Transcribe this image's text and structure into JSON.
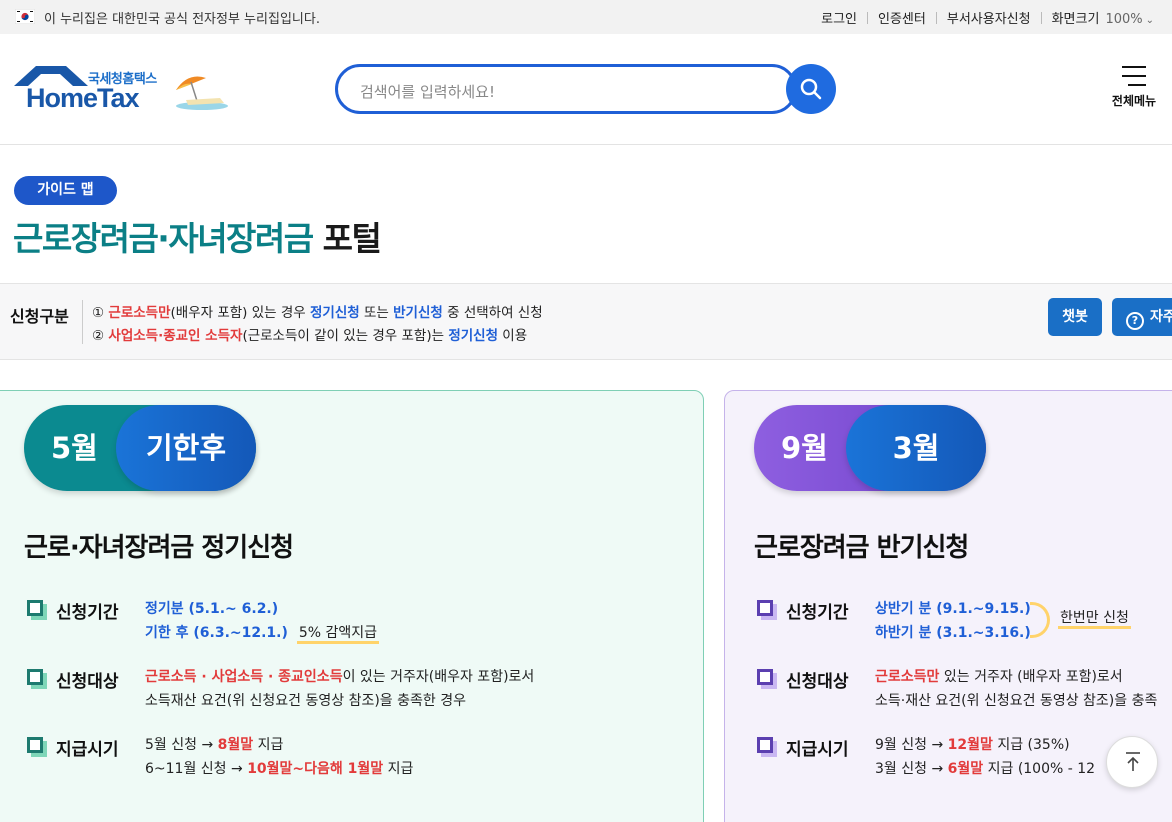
{
  "govbar": {
    "text": "이 누리집은 대한민국 공식 전자정부 누리집입니다.",
    "links": [
      "로그인",
      "인증센터",
      "부서사용자신청"
    ],
    "zoom_label": "화면크기",
    "zoom_value": "100%"
  },
  "header": {
    "logo_kr": "국세청홈택스",
    "logo_en": "HomeTax",
    "search_placeholder": "검색어를 입력하세요!",
    "allmenu_label": "전체메뉴"
  },
  "page": {
    "badge": "가이드 맵",
    "title_teal": "근로장려금·자녀장려금",
    "title_dark": " 포털"
  },
  "band": {
    "label": "신청구분",
    "line1": [
      "① ",
      "근로소득만",
      "(배우자 포함) 있는 경우 ",
      "정기신청",
      " 또는 ",
      "반기신청",
      " 중 선택하여 신청"
    ],
    "line2": [
      "② ",
      "사업소득·종교인 소득자",
      "(근로소득이 같이 있는 경우 포함)는 ",
      "정기신청",
      " 이용"
    ],
    "chat_button": "챗봇",
    "faq_button": "자주"
  },
  "left_card": {
    "pill_a": "5월",
    "pill_b": "기한후",
    "title": "근로·자녀장려금 정기신청",
    "period_label": "신청기간",
    "period_line1": "정기분 (5.1.~ 6.2.)",
    "period_line2": "기한 후 (6.3.~12.1.)",
    "period_note": "5% 감액지급",
    "target_label": "신청대상",
    "target_red": "근로소득 · 사업소득 · 종교인소득",
    "target_rest": "이 있는 거주자(배우자 포함)로서",
    "target_line2": "소득재산 요건(위 신청요건 동영상 참조)을 충족한 경우",
    "pay_label": "지급시기",
    "pay1_pre": "5월 신청 → ",
    "pay1_red": "8월말",
    "pay1_post": " 지급",
    "pay2_pre": "6~11월 신청 → ",
    "pay2_red": "10월말~다음해 1월말",
    "pay2_post": " 지급"
  },
  "right_card": {
    "pill_a": "9월",
    "pill_b": "3월",
    "title": "근로장려금 반기신청",
    "period_label": "신청기간",
    "period_line1": "상반기 분 (9.1.~9.15.)",
    "period_line2": "하반기 분 (3.1.~3.16.)",
    "period_note": "한번만 신청",
    "target_label": "신청대상",
    "target_red": "근로소득만",
    "target_rest": " 있는 거주자 (배우자 포함)로서",
    "target_line2": "소득·재산 요건(위 신청요건 동영상 참조)을 충족",
    "pay_label": "지급시기",
    "pay1_pre": "9월 신청 → ",
    "pay1_red": "12월말",
    "pay1_post": " 지급 (35%)",
    "pay2_pre": "3월 신청 → ",
    "pay2_red": "6월말",
    "pay2_post": " 지급 (100% - 12"
  },
  "colors": {
    "primary": "#1f5fd6",
    "teal": "#0b7f86",
    "red": "#e23b3b",
    "purple": "#6e3fc8"
  }
}
